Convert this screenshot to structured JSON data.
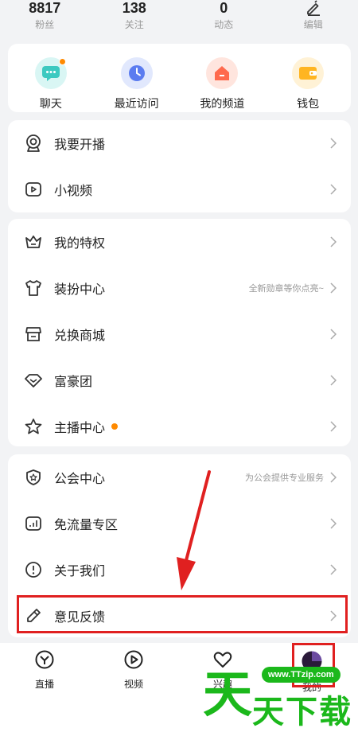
{
  "stats": [
    {
      "value": "8817",
      "label": "粉丝"
    },
    {
      "value": "138",
      "label": "关注"
    },
    {
      "value": "0",
      "label": "动态"
    },
    {
      "value": "",
      "label": "编辑"
    }
  ],
  "quick": [
    {
      "label": "聊天",
      "icon": "chat-icon",
      "color": "#3cc9c0"
    },
    {
      "label": "最近访问",
      "icon": "clock-icon",
      "color": "#5b7cf0"
    },
    {
      "label": "我的频道",
      "icon": "home-icon",
      "color": "#ff6a4d"
    },
    {
      "label": "钱包",
      "icon": "wallet-icon",
      "color": "#ffb522"
    }
  ],
  "group1": [
    {
      "label": "我要开播",
      "icon": "live-camera-icon"
    },
    {
      "label": "小视频",
      "icon": "video-icon"
    }
  ],
  "group2": [
    {
      "label": "我的特权",
      "icon": "crown-icon",
      "hint": ""
    },
    {
      "label": "装扮中心",
      "icon": "tshirt-icon",
      "hint": "全新勋章等你点亮~"
    },
    {
      "label": "兑换商城",
      "icon": "store-icon",
      "hint": ""
    },
    {
      "label": "富豪团",
      "icon": "diamond-icon",
      "hint": ""
    },
    {
      "label": "主播中心",
      "icon": "star-icon",
      "hint": ""
    }
  ],
  "group3": [
    {
      "label": "公会中心",
      "icon": "shield-icon",
      "hint": "为公会提供专业服务"
    },
    {
      "label": "免流量专区",
      "icon": "signal-icon",
      "hint": ""
    },
    {
      "label": "关于我们",
      "icon": "info-icon",
      "hint": ""
    },
    {
      "label": "意见反馈",
      "icon": "pencil-icon",
      "hint": ""
    }
  ],
  "tabs": [
    {
      "label": "直播"
    },
    {
      "label": "视频"
    },
    {
      "label": "兴趣"
    },
    {
      "label": "我的"
    }
  ],
  "watermark": {
    "char1": "天",
    "char2": "天",
    "char3": "下",
    "char4": "载",
    "url": "www.TTzip.com"
  },
  "colors": {
    "accent": "#ff8a00",
    "highlight": "#e02020",
    "watermark": "#1bb81b"
  }
}
